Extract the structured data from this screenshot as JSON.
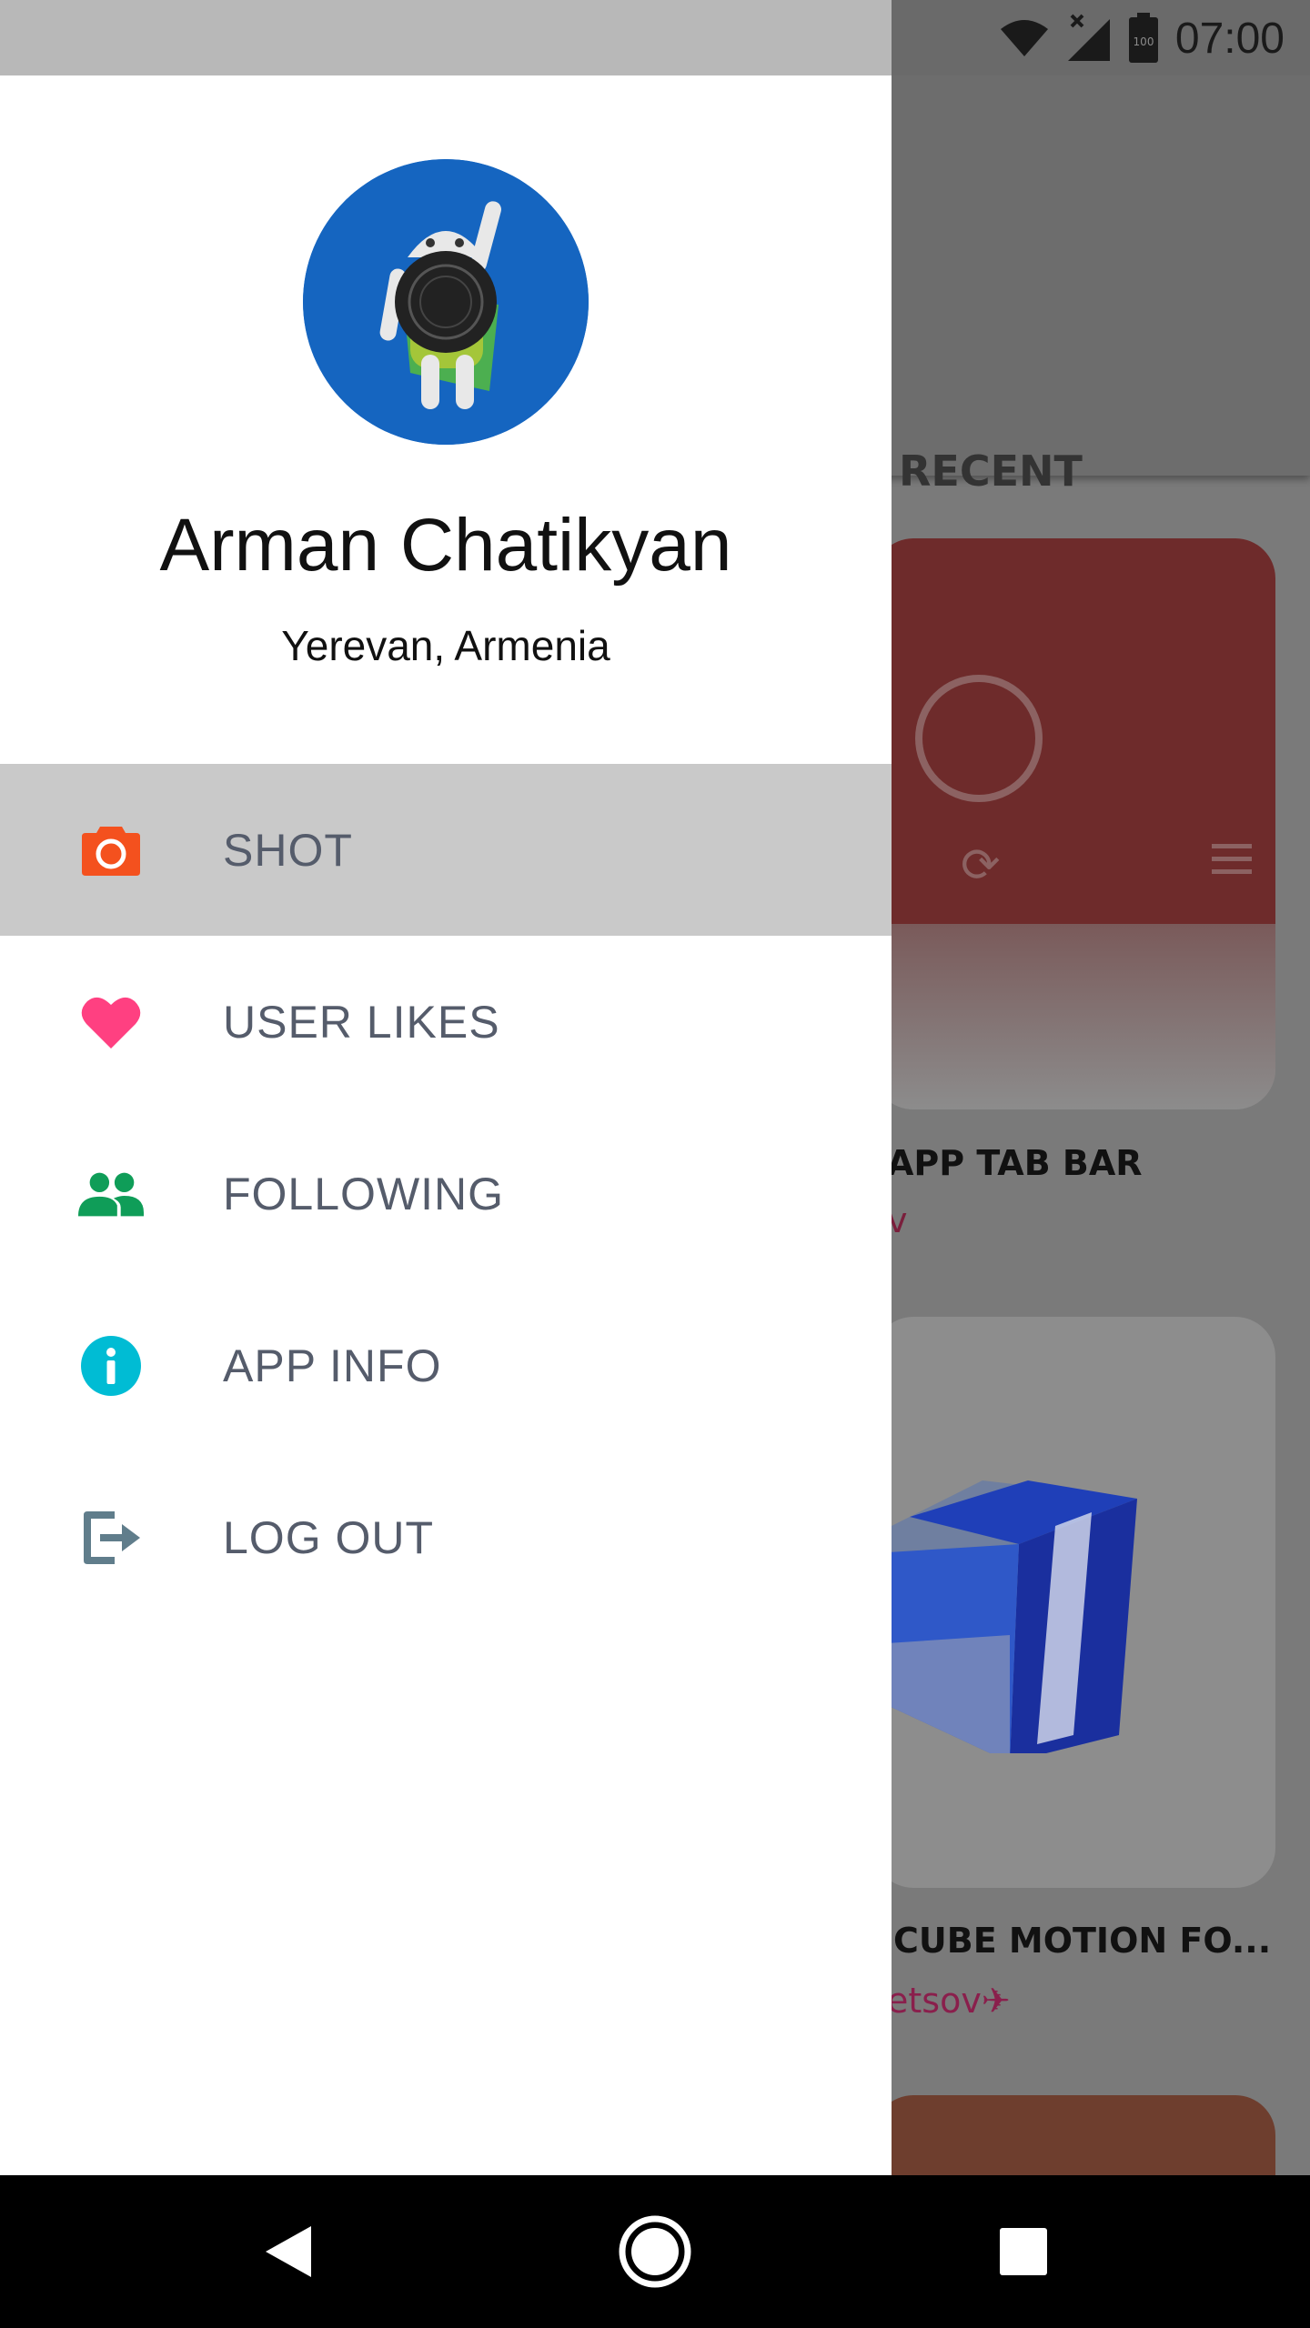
{
  "status_bar": {
    "time": "07:00",
    "battery": "100"
  },
  "background": {
    "tab_recent": "RECENT",
    "card1_title": "APP TAB BAR",
    "card1_author": "v",
    "card2_title": "CUBE MOTION FO...",
    "card2_author": "etsov✈"
  },
  "drawer": {
    "user_name": "Arman Chatikyan",
    "user_location": "Yerevan, Armenia",
    "items": [
      {
        "label": "SHOT",
        "icon": "camera-icon",
        "color": "#f4511e",
        "active": true
      },
      {
        "label": "USER LIKES",
        "icon": "heart-icon",
        "color": "#ff4081",
        "active": false
      },
      {
        "label": "FOLLOWING",
        "icon": "people-icon",
        "color": "#0f9d58",
        "active": false
      },
      {
        "label": "APP INFO",
        "icon": "info-icon",
        "color": "#00bcd4",
        "active": false
      },
      {
        "label": "LOG OUT",
        "icon": "logout-icon",
        "color": "#607d8b",
        "active": false
      }
    ]
  },
  "nav_bar": {
    "back": "back-icon",
    "home": "home-icon",
    "recents": "recents-icon"
  }
}
